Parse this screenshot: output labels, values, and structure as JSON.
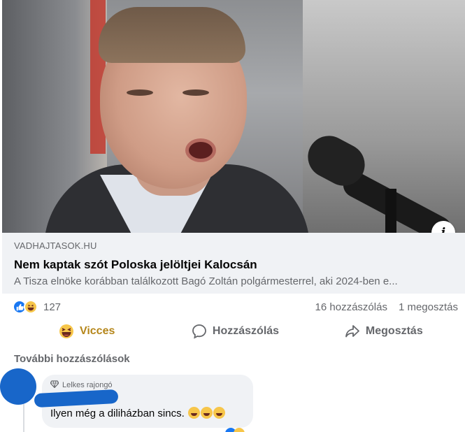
{
  "post": {
    "link_domain": "VADHAJTASOK.HU",
    "link_title": "Nem kaptak szót Poloska jelöltjei Kalocsán",
    "link_description": "A Tisza elnöke korábban találkozott Bagó Zoltán polgármesterrel, aki 2024-ben e...",
    "info_label": "i"
  },
  "stats": {
    "reaction_count": "127",
    "comments": "16 hozzászólás",
    "shares": "1 megosztás"
  },
  "actions": {
    "react_label": "Vicces",
    "comment_label": "Hozzászólás",
    "share_label": "Megosztás"
  },
  "comments_section": {
    "more_comments_label": "További hozzászólások",
    "comment": {
      "badge": "Lelkes rajongó",
      "text": "Ilyen még a diliházban sincs."
    }
  },
  "colors": {
    "brand_blue": "#1877f2",
    "vicces_gold": "#b5861a",
    "muted_text": "#65676b",
    "link_box_bg": "#f0f2f5"
  },
  "icons": {
    "reaction_like": "thumbs-up-icon",
    "reaction_haha": "haha-emoji-icon",
    "comment": "speech-bubble-icon",
    "share": "share-arrow-icon",
    "badge": "diamond-icon"
  }
}
